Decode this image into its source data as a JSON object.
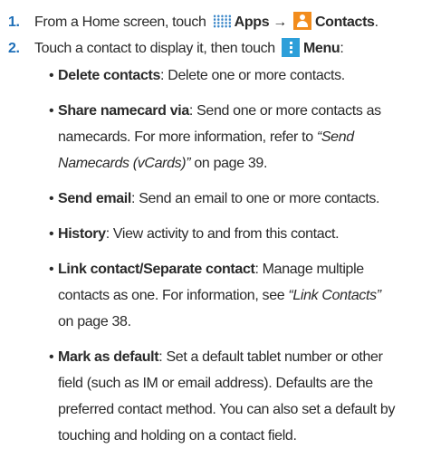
{
  "steps": [
    {
      "num": "1.",
      "pre": "From a Home screen, touch",
      "apps_label": "Apps",
      "arrow": "→",
      "contacts_label": "Contacts",
      "end": "."
    },
    {
      "num": "2.",
      "pre": "Touch a contact to display it, then touch",
      "menu_label": "Menu",
      "end": ":"
    }
  ],
  "bullets": [
    {
      "term": "Delete contacts",
      "lines": [
        "Delete one or more contacts."
      ]
    },
    {
      "term": "Share namecard via",
      "lines": [
        "Send one or more contacts as",
        "namecards. For more information, refer to",
        "on page 39."
      ],
      "xref1": "“Send",
      "xref2": "Namecards (vCards)”"
    },
    {
      "term": "Send email",
      "lines": [
        "Send an email to one or more contacts."
      ]
    },
    {
      "term": "History",
      "lines": [
        "View activity to and from this contact."
      ]
    },
    {
      "term": "Link contact/Separate contact",
      "lines": [
        "Manage multiple",
        "contacts as one. For information, see",
        "on page 38."
      ],
      "xref": "“Link Contacts”"
    },
    {
      "term": "Mark as default",
      "lines": [
        "Set a default tablet number or other",
        "field (such as IM or email address). Defaults are the",
        "preferred contact method. You can also set a default by",
        "touching and holding on a contact field."
      ]
    }
  ],
  "icons": {
    "apps": "apps-grid-icon",
    "contacts": "contacts-icon",
    "menu": "menu-icon"
  },
  "colors": {
    "step_number": "#1e6fb8",
    "text": "#2a2a2a",
    "contacts_icon": "#f28c1c",
    "menu_icon": "#2d9fd9",
    "apps_icon": "#3a86c8"
  }
}
